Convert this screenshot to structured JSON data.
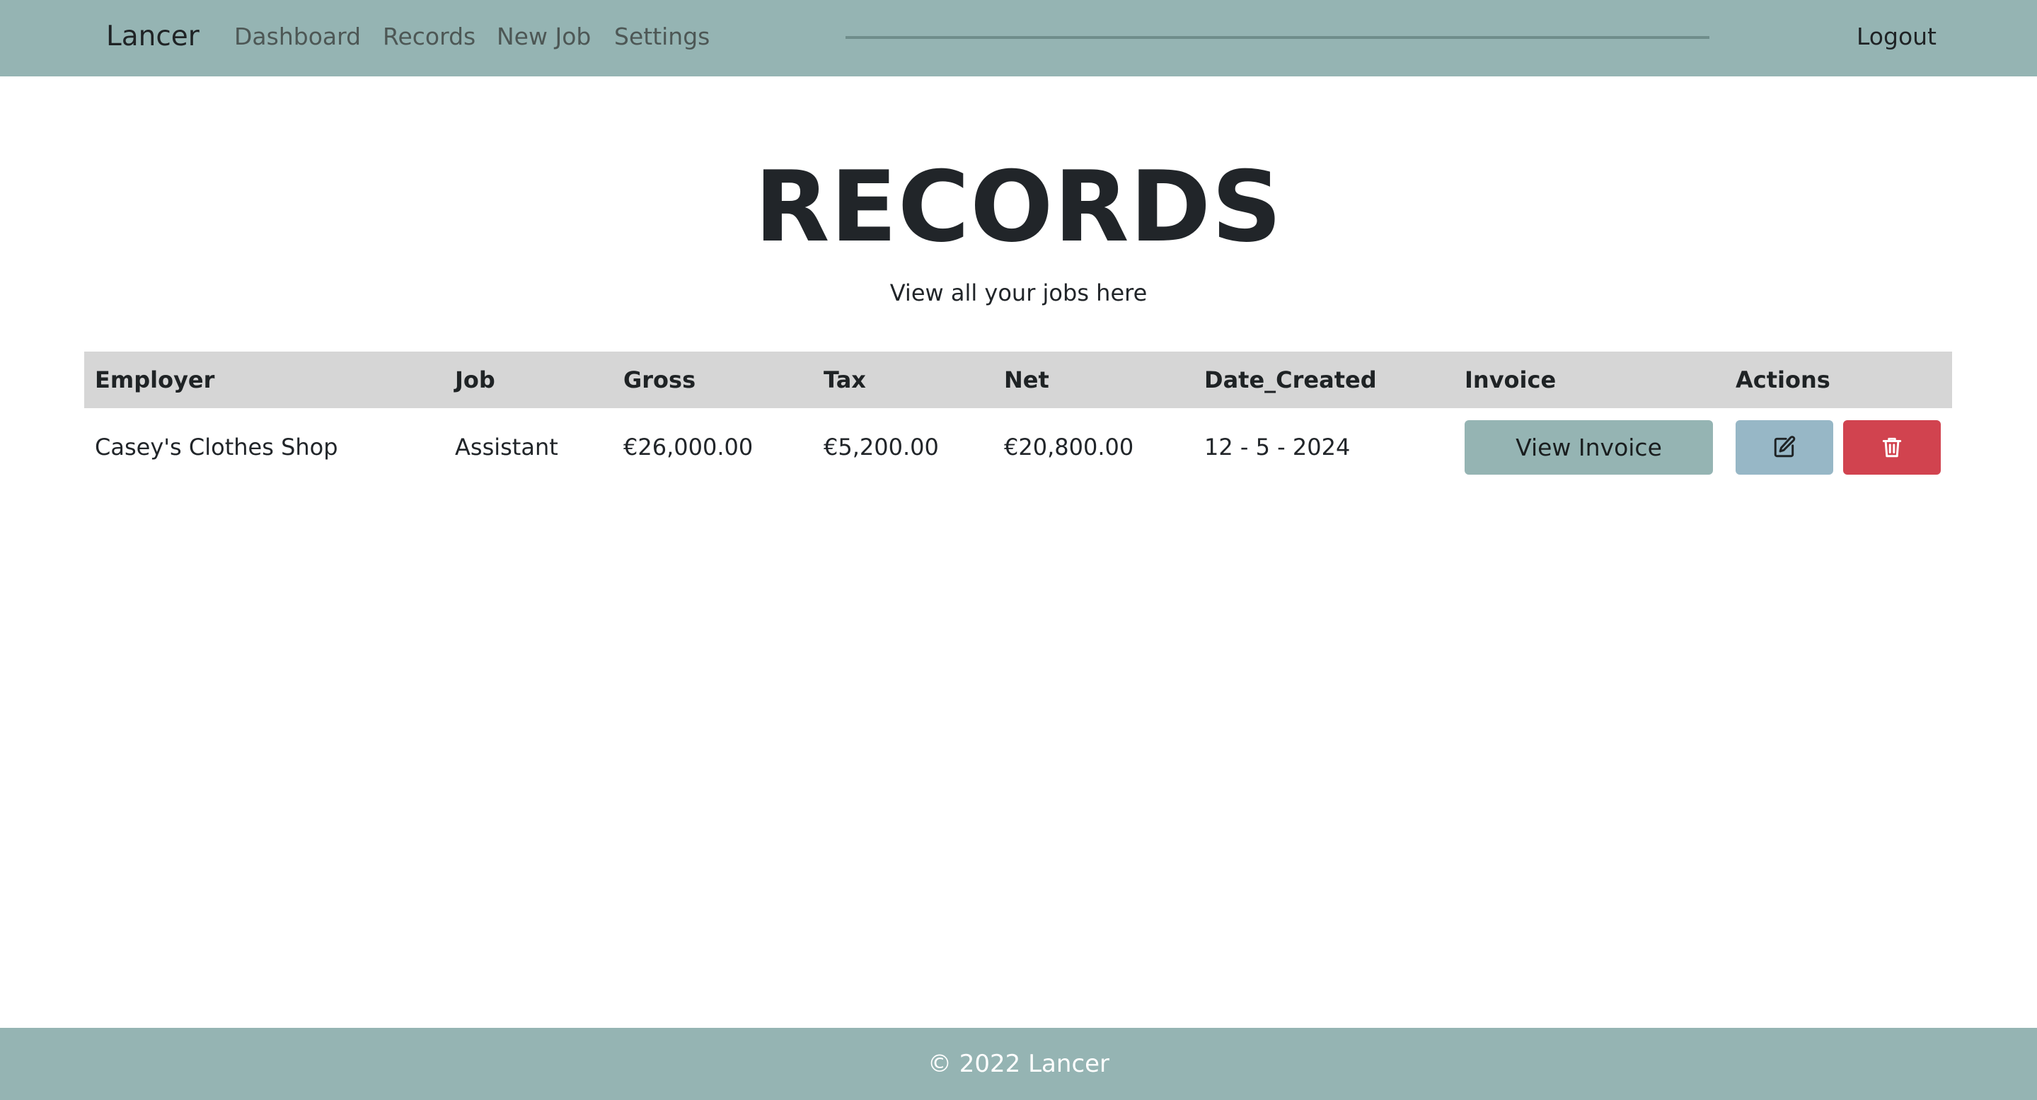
{
  "navbar": {
    "brand": "Lancer",
    "links": [
      "Dashboard",
      "Records",
      "New Job",
      "Settings"
    ],
    "logout": "Logout"
  },
  "header": {
    "title": "RECORDS",
    "subtitle": "View all your jobs here"
  },
  "table": {
    "columns": [
      "Employer",
      "Job",
      "Gross",
      "Tax",
      "Net",
      "Date_Created",
      "Invoice",
      "Actions"
    ],
    "rows": [
      {
        "employer": "Casey's Clothes Shop",
        "job": "Assistant",
        "gross": "€26,000.00",
        "tax": "€5,200.00",
        "net": "€20,800.00",
        "date_created": "12 - 5 - 2024",
        "invoice_button": "View Invoice"
      }
    ]
  },
  "icons": {
    "edit": "pencil-square-icon",
    "delete": "trash-icon"
  },
  "footer": {
    "text": "© 2022 Lancer"
  },
  "colors": {
    "navbar_bg": "#95b4b3",
    "table_header_bg": "#d6d6d6",
    "invoice_button": "#95b4b3",
    "edit_button": "#97b7c6",
    "delete_button": "#d1434f"
  }
}
